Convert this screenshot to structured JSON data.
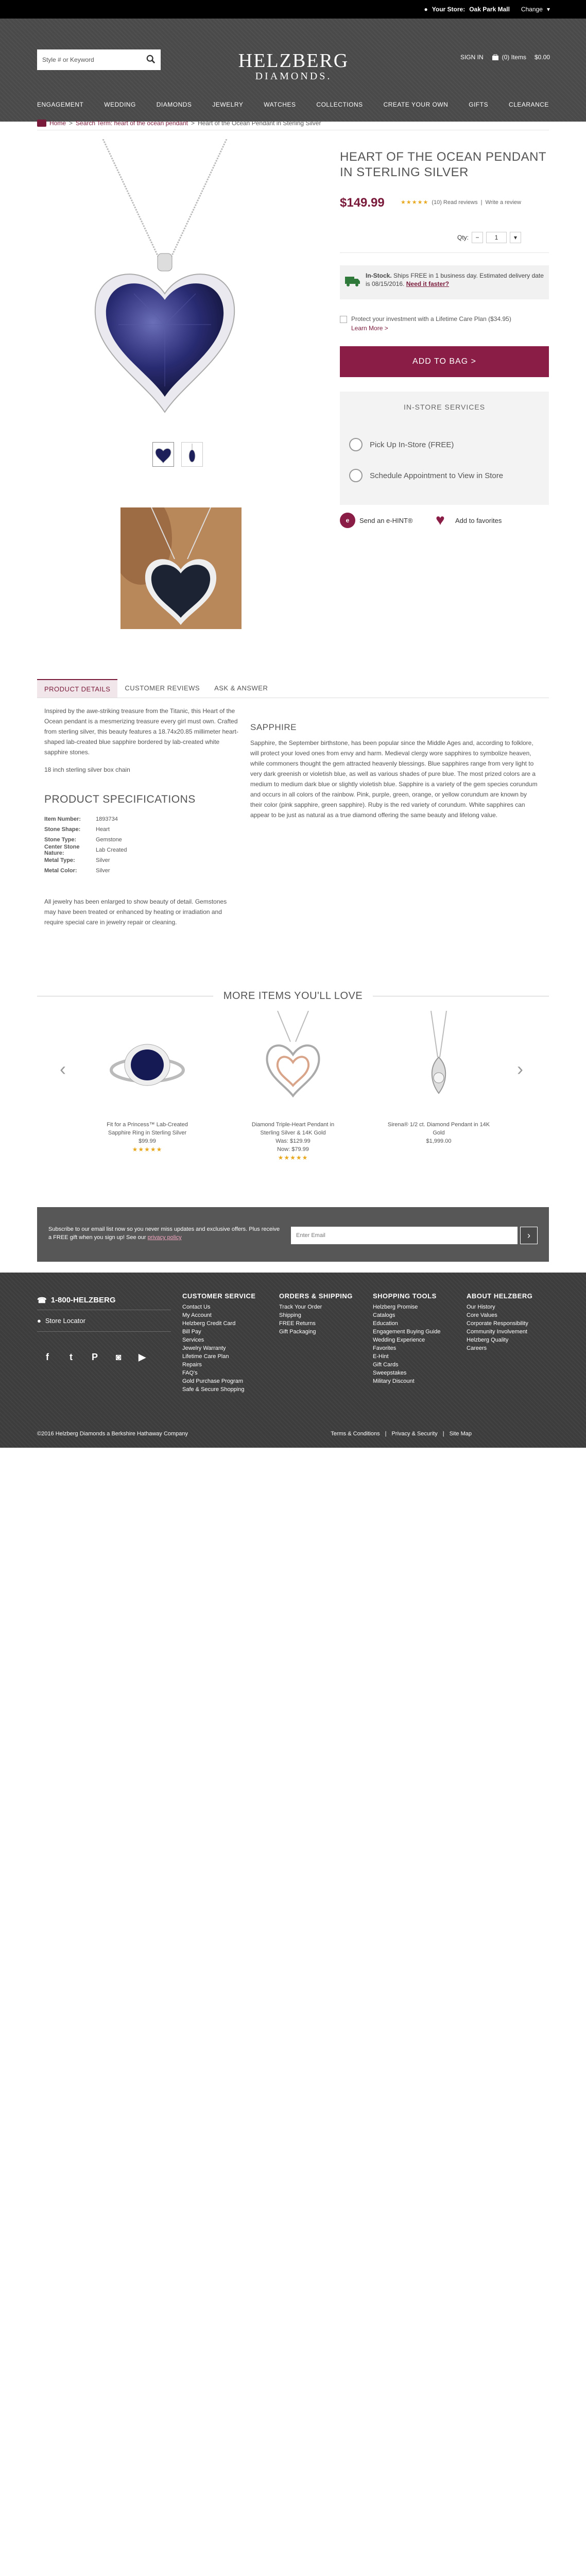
{
  "topbar": {
    "store_label": "Your Store:",
    "store_name": "Oak Park Mall",
    "change": "Change"
  },
  "header": {
    "search_placeholder": "Style # or Keyword",
    "logo_line1": "HELZBERG",
    "logo_line2": "DIAMONDS.",
    "sign_in": "SIGN IN",
    "bag_items": "(0) Items",
    "bag_total": "$0.00",
    "nav": [
      "ENGAGEMENT",
      "WEDDING",
      "DIAMONDS",
      "JEWELRY",
      "WATCHES",
      "COLLECTIONS",
      "CREATE YOUR OWN",
      "GIFTS",
      "CLEARANCE"
    ]
  },
  "breadcrumb": {
    "home": "Home",
    "search": "Search Term: heart of the ocean pendant",
    "current": "Heart of the Ocean Pendant in Sterling Silver"
  },
  "product": {
    "title": "HEART OF THE OCEAN PENDANT IN STERLING SILVER",
    "price": "$149.99",
    "stars": "★★★★★",
    "reviews": "(10) Read reviews",
    "write_review": "Write a review",
    "qty_label": "Qty:",
    "qty_value": "1",
    "stock_title": "In-Stock.",
    "stock_text": " Ships FREE in 1 business day. Estimated delivery date is 08/15/2016.",
    "need_faster": "Need it faster?",
    "care_text": "Protect your investment with a Lifetime Care Plan ($34.95)",
    "learn_more": "Learn More >",
    "add_to_bag": "ADD TO BAG >",
    "instore_heading": "IN-STORE SERVICES",
    "pickup": "Pick Up In-Store (FREE)",
    "schedule": "Schedule Appointment to View in Store",
    "ehint": "Send an e-HINT®",
    "favorites": "Add to favorites"
  },
  "tabs": [
    "PRODUCT DETAILS",
    "CUSTOMER REVIEWS",
    "ASK & ANSWER"
  ],
  "details": {
    "desc": "Inspired by the awe-striking treasure from the Titanic, this Heart of the Ocean pendant is a mesmerizing treasure every girl must own. Crafted from sterling silver, this beauty features a 18.74x20.85 millimeter heart-shaped lab-created blue sapphire bordered by lab-created white sapphire stones.",
    "chain": "18 inch sterling silver box chain",
    "specs_heading": "PRODUCT SPECIFICATIONS",
    "specs": [
      {
        "k": "Item Number:",
        "v": "1893734"
      },
      {
        "k": "Stone Shape:",
        "v": "Heart"
      },
      {
        "k": "Stone Type:",
        "v": "Gemstone"
      },
      {
        "k": "Center Stone Nature:",
        "v": "Lab Created"
      },
      {
        "k": "Metal Type:",
        "v": "Silver"
      },
      {
        "k": "Metal Color:",
        "v": "Silver"
      }
    ],
    "enhance": "All jewelry has been enlarged to show beauty of detail. Gemstones may have been treated or enhanced by heating or irradiation and require special care in jewelry repair or cleaning.",
    "sapphire_heading": "SAPPHIRE",
    "sapphire_text": "Sapphire, the September birthstone, has been popular since the Middle Ages and, according to folklore, will protect your loved ones from envy and harm. Medieval clergy wore sapphires to symbolize heaven, while commoners thought the gem attracted heavenly blessings. Blue sapphires range from very light to very dark greenish or violetish blue, as well as various shades of pure blue. The most prized colors are a medium to medium dark blue or slightly violetish blue. Sapphire is a variety of the gem species corundum and occurs in all colors of the rainbow. Pink, purple, green, orange, or yellow corundum are known by their color (pink sapphire, green sapphire). Ruby is the red variety of corundum. White sapphires can appear to be just as natural as a true diamond offering the same beauty and lifelong value."
  },
  "more": {
    "heading": "MORE ITEMS YOU'LL LOVE",
    "items": [
      {
        "name": "Fit for a Princess™ Lab-Created Sapphire Ring in Sterling Silver",
        "price": "$99.99",
        "was": "",
        "stars": "★★★★★"
      },
      {
        "name": "Diamond Triple-Heart Pendant in Sterling Silver & 14K Gold",
        "price": "Now: $79.99",
        "was": "Was: $129.99",
        "stars": "★★★★★"
      },
      {
        "name": "Sirena® 1/2 ct. Diamond Pendant in 14K Gold",
        "price": "$1,999.00",
        "was": "",
        "stars": ""
      }
    ]
  },
  "email": {
    "text": "Subscribe to our email list now so you never miss updates and exclusive offers. Plus receive a FREE gift when you sign up! See our ",
    "privacy": "privacy policy",
    "placeholder": "Enter Email",
    "go": "›"
  },
  "footer": {
    "phone": "1-800-HELZBERG",
    "store_locator": "Store Locator",
    "columns": [
      {
        "h": "CUSTOMER SERVICE",
        "items": [
          "Contact Us",
          "My Account",
          "Helzberg Credit Card",
          "Bill Pay",
          "Services",
          "Jewelry Warranty",
          "Lifetime Care Plan",
          "Repairs",
          "FAQ's",
          "Gold Purchase Program",
          "Safe & Secure Shopping"
        ]
      },
      {
        "h": "ORDERS & SHIPPING",
        "items": [
          "Track Your Order",
          "Shipping",
          "FREE Returns",
          "Gift Packaging"
        ]
      },
      {
        "h": "SHOPPING TOOLS",
        "items": [
          "Helzberg Promise",
          "Catalogs",
          "Education",
          "Engagement Buying Guide",
          "Wedding Experience",
          "Favorites",
          "E-Hint",
          "Gift Cards",
          "Sweepstakes",
          "Military Discount"
        ]
      },
      {
        "h": "ABOUT HELZBERG",
        "items": [
          "Our History",
          "Core Values",
          "Corporate Responsibility",
          "Community Involvement",
          "Helzberg Quality",
          "Careers"
        ]
      }
    ],
    "copyright": "©2016 Helzberg Diamonds a Berkshire Hathaway Company",
    "terms": "Terms & Conditions",
    "privacy": "Privacy & Security",
    "sitemap": "Site Map"
  },
  "colors": {
    "brand": "#8a1d45",
    "stars": "#e8a81e",
    "header": "#4a4a4a"
  }
}
